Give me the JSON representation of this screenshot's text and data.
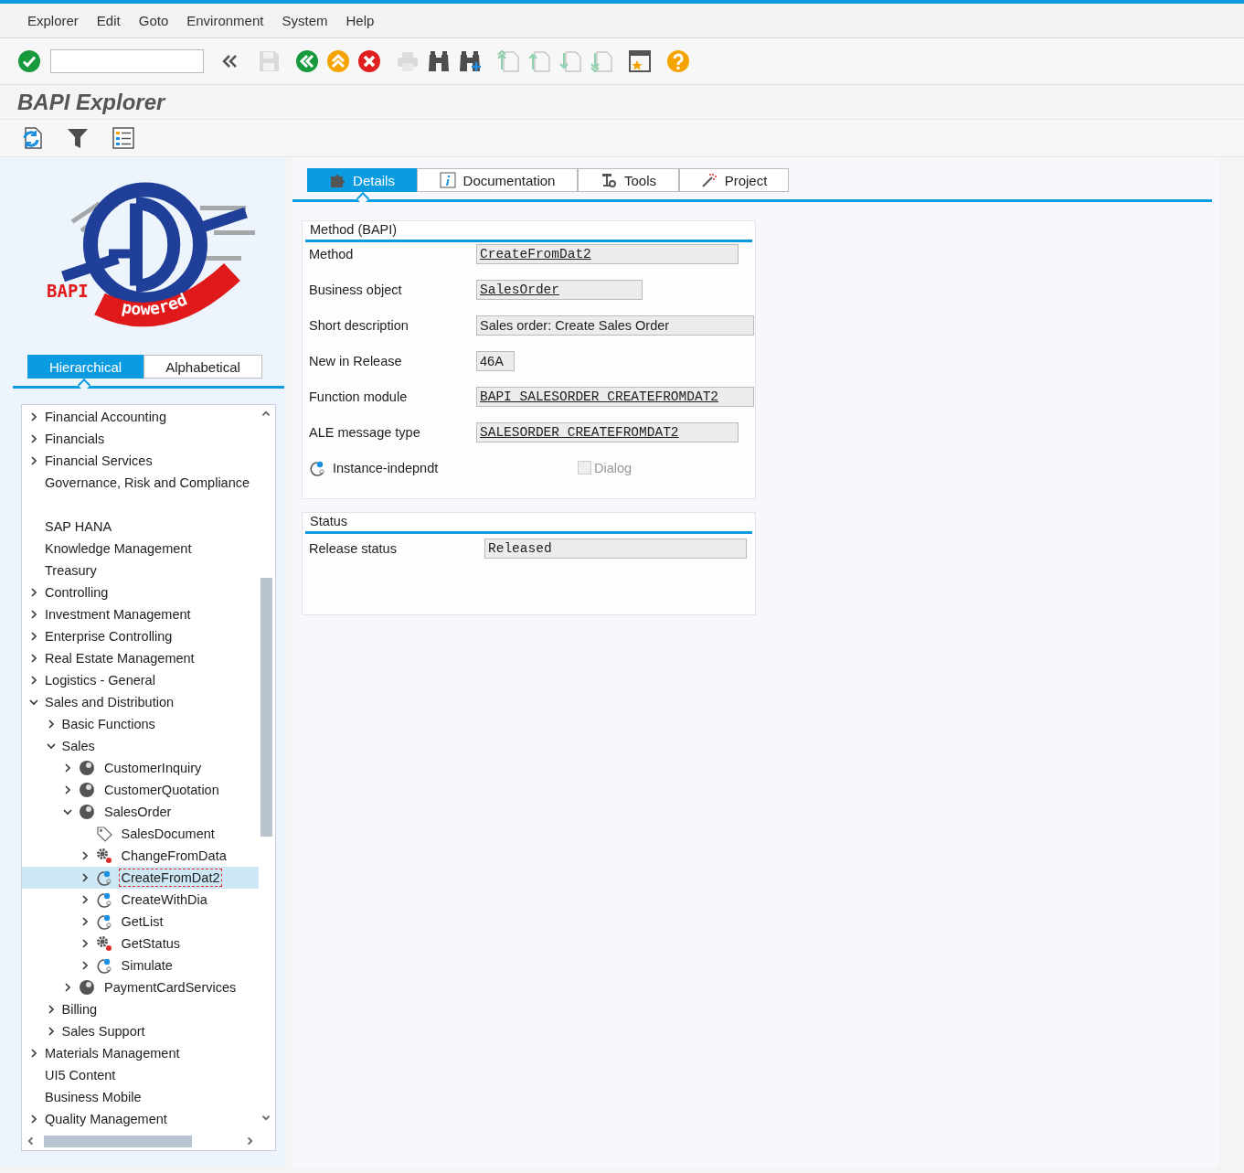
{
  "menu": [
    "Explorer",
    "Edit",
    "Goto",
    "Environment",
    "System",
    "Help"
  ],
  "toolbar": [
    {
      "kind": "enter",
      "disabled": false
    },
    {
      "kind": "command_field",
      "disabled": false
    },
    {
      "kind": "collapse",
      "disabled": false
    },
    {
      "kind": "save",
      "disabled": true
    },
    {
      "kind": "back",
      "disabled": false
    },
    {
      "kind": "exit",
      "disabled": false
    },
    {
      "kind": "cancel",
      "disabled": false
    },
    {
      "kind": "print",
      "disabled": true
    },
    {
      "kind": "find",
      "disabled": false
    },
    {
      "kind": "find_next",
      "disabled": false
    },
    {
      "kind": "first_page",
      "disabled": false
    },
    {
      "kind": "previous_page",
      "disabled": false
    },
    {
      "kind": "next_page",
      "disabled": false
    },
    {
      "kind": "last_page",
      "disabled": false
    },
    {
      "kind": "new_window",
      "disabled": false
    },
    {
      "kind": "help",
      "disabled": false
    }
  ],
  "title": "BAPI Explorer",
  "logo": {
    "text_1": "BAPI",
    "text_2": "powered"
  },
  "view_tabs": [
    {
      "label": "Hierarchical",
      "selected": true
    },
    {
      "label": "Alphabetical",
      "selected": false
    }
  ],
  "tree": [
    {
      "label": "Financial Accounting",
      "expanded": false,
      "selected": false
    },
    {
      "label": "Financials",
      "expanded": false,
      "selected": false
    },
    {
      "label": "Financial Services",
      "expanded": false,
      "selected": false
    },
    {
      "label": "Governance, Risk and Compliance",
      "selected": false
    },
    {
      "label": "SAP HANA",
      "selected": false
    },
    {
      "label": "Knowledge Management",
      "selected": false
    },
    {
      "label": "Treasury",
      "selected": false
    },
    {
      "label": "Controlling",
      "expanded": false,
      "selected": false
    },
    {
      "label": "Investment Management",
      "expanded": false,
      "selected": false
    },
    {
      "label": "Enterprise Controlling",
      "expanded": false,
      "selected": false
    },
    {
      "label": "Real Estate Management",
      "expanded": false,
      "selected": false
    },
    {
      "label": "Logistics - General",
      "expanded": false,
      "selected": false
    },
    {
      "label": "Sales and Distribution",
      "expanded": true,
      "selected": false,
      "children": [
        {
          "label": "Basic Functions",
          "expanded": false,
          "selected": false
        },
        {
          "label": "Sales",
          "expanded": true,
          "selected": false,
          "children": [
            {
              "label": "CustomerInquiry",
              "kind": "object",
              "expanded": false,
              "selected": false
            },
            {
              "label": "CustomerQuotation",
              "kind": "object",
              "expanded": false,
              "selected": false
            },
            {
              "label": "SalesOrder",
              "kind": "object",
              "expanded": true,
              "selected": false,
              "children": [
                {
                  "label": "SalesDocument",
                  "kind": "key_field",
                  "selected": false
                },
                {
                  "label": "ChangeFromData",
                  "kind": "method",
                  "expanded": false,
                  "selected": false
                },
                {
                  "label": "CreateFromDat2",
                  "kind": "static_method",
                  "expanded": false,
                  "selected": true
                },
                {
                  "label": "CreateWithDia",
                  "kind": "static_method",
                  "expanded": false,
                  "selected": false
                },
                {
                  "label": "GetList",
                  "kind": "static_method",
                  "expanded": false,
                  "selected": false
                },
                {
                  "label": "GetStatus",
                  "kind": "method",
                  "expanded": false,
                  "selected": false
                },
                {
                  "label": "Simulate",
                  "kind": "static_method",
                  "expanded": false,
                  "selected": false
                }
              ]
            },
            {
              "label": "PaymentCardServices",
              "kind": "object",
              "expanded": false,
              "selected": false
            }
          ]
        },
        {
          "label": "Billing",
          "expanded": false,
          "selected": false
        },
        {
          "label": "Sales Support",
          "expanded": false,
          "selected": false
        }
      ]
    },
    {
      "label": "Materials Management",
      "expanded": false,
      "selected": false
    },
    {
      "label": "UI5 Content",
      "selected": false
    },
    {
      "label": "Business Mobile",
      "selected": false
    },
    {
      "label": "Quality Management",
      "expanded": false,
      "selected": false
    }
  ],
  "detail_tabs": [
    {
      "label": "Details",
      "selected": true
    },
    {
      "label": "Documentation",
      "selected": false
    },
    {
      "label": "Tools",
      "selected": false
    },
    {
      "label": "Project",
      "selected": false
    }
  ],
  "method_group": {
    "title": "Method (BAPI)",
    "fields": [
      {
        "label": "Method",
        "value": "CreateFromDat2",
        "kind": "link"
      },
      {
        "label": "Business object",
        "value": "SalesOrder",
        "kind": "link"
      },
      {
        "label": "Short description",
        "value": "Sales order: Create Sales Order",
        "kind": "text"
      },
      {
        "label": "New in Release",
        "value": "46A",
        "kind": "text"
      },
      {
        "label": "Function module",
        "value": "BAPI_SALESORDER_CREATEFROMDAT2",
        "kind": "link"
      },
      {
        "label": "ALE message type",
        "value": "SALESORDER_CREATEFROMDAT2",
        "kind": "link"
      }
    ],
    "instance_label": "Instance-indepndt",
    "dialog": {
      "label": "Dialog",
      "checked": false,
      "disabled": true
    }
  },
  "status_group": {
    "title": "Status",
    "fields": [
      {
        "label": "Release status",
        "value": "Released",
        "kind": "mono"
      }
    ]
  }
}
